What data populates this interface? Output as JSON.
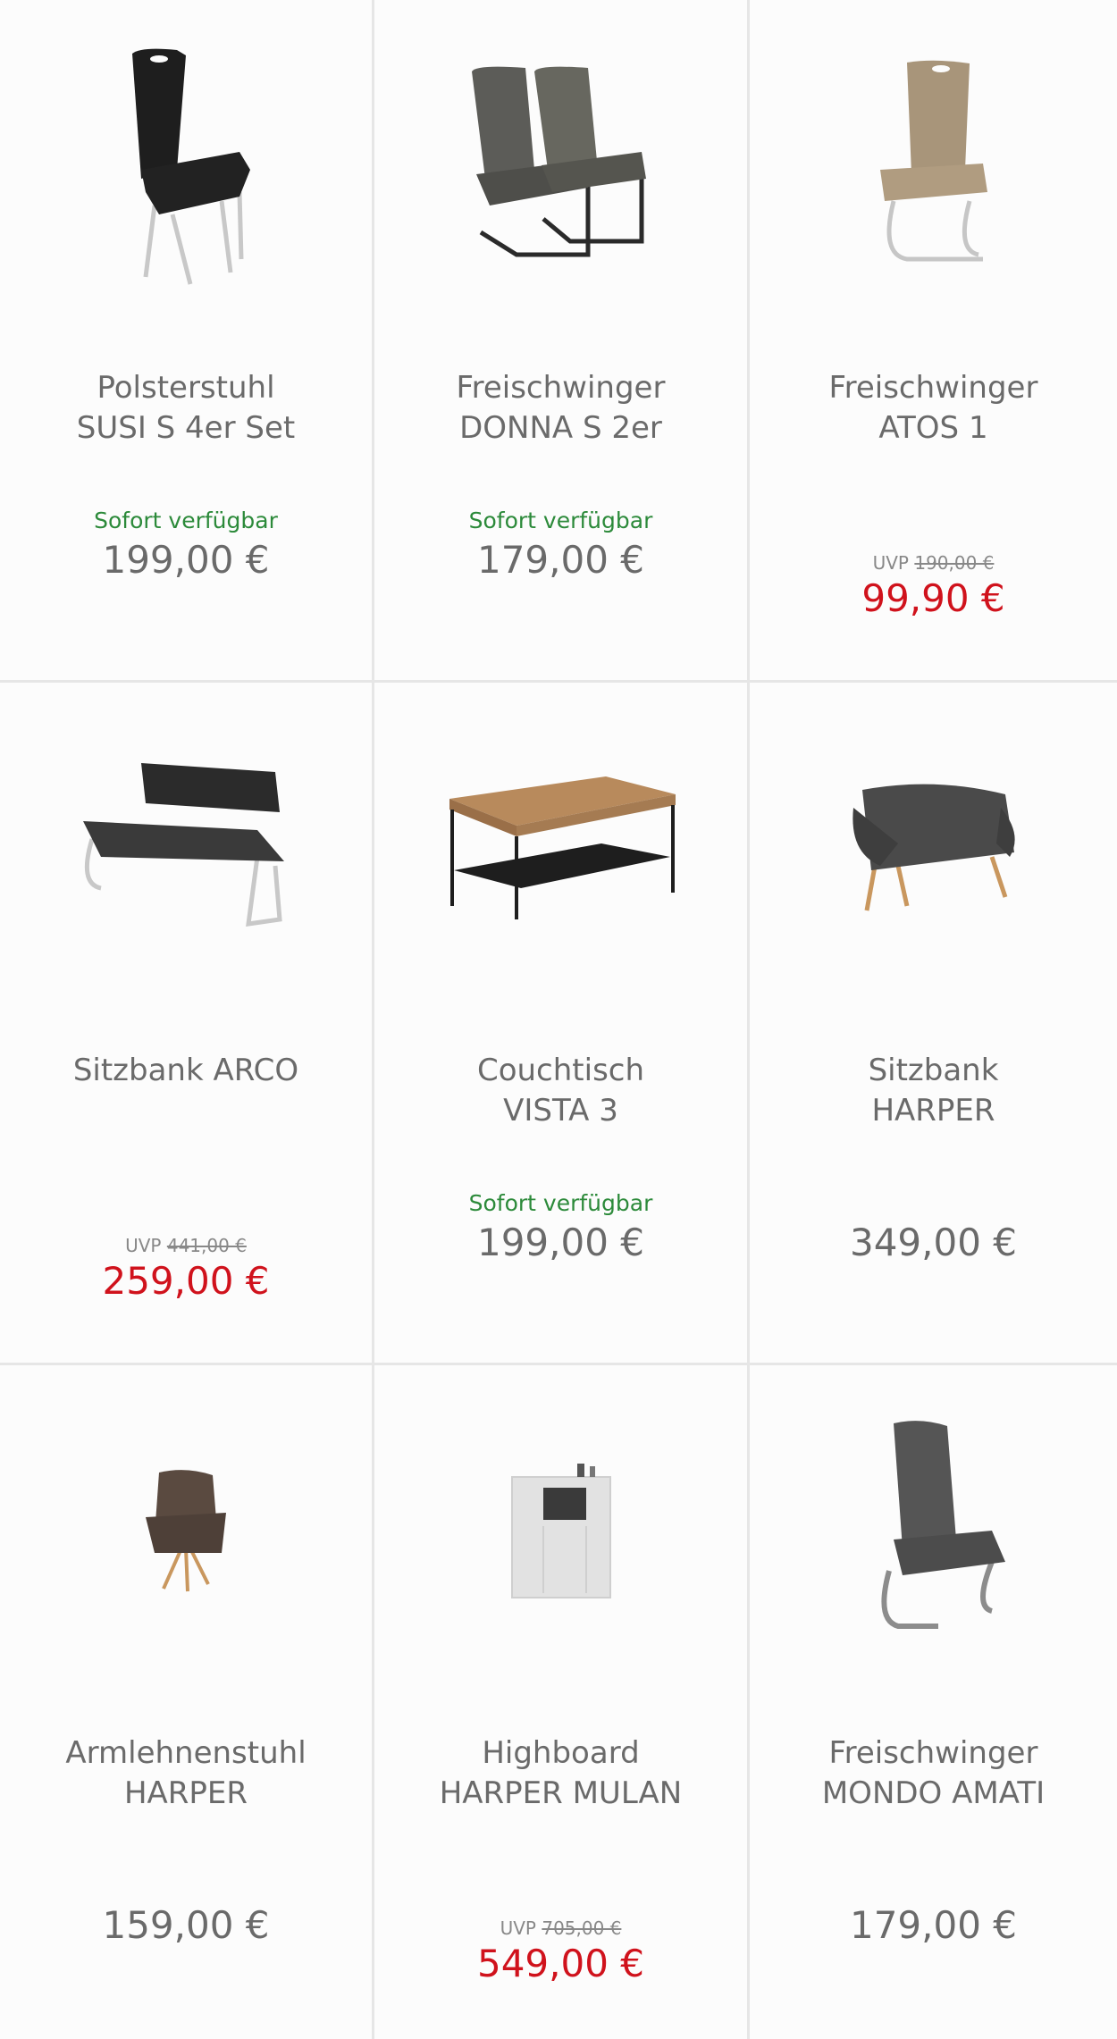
{
  "products": [
    {
      "title_line1": "Polsterstuhl",
      "title_line2": "SUSI S 4er Set",
      "availability": "Sofort verfügbar",
      "price": "199,00 €",
      "image": "black-upholstered-chair"
    },
    {
      "title_line1": "Freischwinger",
      "title_line2": "DONNA S 2er",
      "availability": "Sofort verfügbar",
      "price": "179,00 €",
      "image": "grey-cantilever-chairs-pair"
    },
    {
      "title_line1": "Freischwinger",
      "title_line2": "ATOS 1",
      "uvp_label": "UVP",
      "uvp_price": "190,00 €",
      "sale_price": "99,90 €",
      "image": "taupe-cantilever-chair"
    },
    {
      "title_line1": "Sitzbank ARCO",
      "uvp_label": "UVP",
      "uvp_price": "441,00 €",
      "sale_price": "259,00 €",
      "image": "black-bench"
    },
    {
      "title_line1": "Couchtisch",
      "title_line2": "VISTA 3",
      "availability": "Sofort verfügbar",
      "price": "199,00 €",
      "image": "wood-coffee-table"
    },
    {
      "title_line1": "Sitzbank",
      "title_line2": "HARPER",
      "price": "349,00 €",
      "image": "grey-upholstered-bench"
    },
    {
      "title_line1": "Armlehnenstuhl",
      "title_line2": "HARPER",
      "price": "159,00 €",
      "image": "brown-armchair"
    },
    {
      "title_line1": "Highboard",
      "title_line2": "HARPER MULAN",
      "uvp_label": "UVP",
      "uvp_price": "705,00 €",
      "sale_price": "549,00 €",
      "image": "white-highboard"
    },
    {
      "title_line1": "Freischwinger",
      "title_line2": "MONDO AMATI",
      "price": "179,00 €",
      "image": "grey-cantilever-chair"
    }
  ],
  "colors": {
    "availability": "#2c8a3a",
    "sale": "#d0121c",
    "text": "#6a6a6a",
    "divider": "#e6e6e6"
  }
}
